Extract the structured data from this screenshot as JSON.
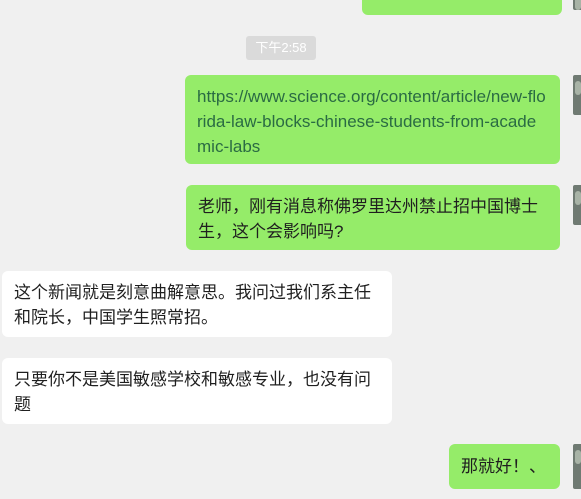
{
  "timestamp": "下午2:58",
  "messages": [
    {
      "id": "prev",
      "sender": "self",
      "text": ""
    },
    {
      "id": "link",
      "sender": "self",
      "text": "https://www.science.org/content/article/new-florida-law-blocks-chinese-students-from-academic-labs"
    },
    {
      "id": "question",
      "sender": "self",
      "text": "老师，刚有消息称佛罗里达州禁止招中国博士生，这个会影响吗?"
    },
    {
      "id": "reply1",
      "sender": "other",
      "text": "这个新闻就是刻意曲解意思。我问过我们系主任和院长，中国学生照常招。"
    },
    {
      "id": "reply2",
      "sender": "other",
      "text": "只要你不是美国敏感学校和敏感专业，也没有问题"
    },
    {
      "id": "thanks",
      "sender": "self",
      "text": "那就好！、"
    }
  ],
  "colors": {
    "self_bubble": "#95ec69",
    "other_bubble": "#ffffff",
    "background": "#f0f0f0",
    "link_text": "#2a6b43"
  }
}
